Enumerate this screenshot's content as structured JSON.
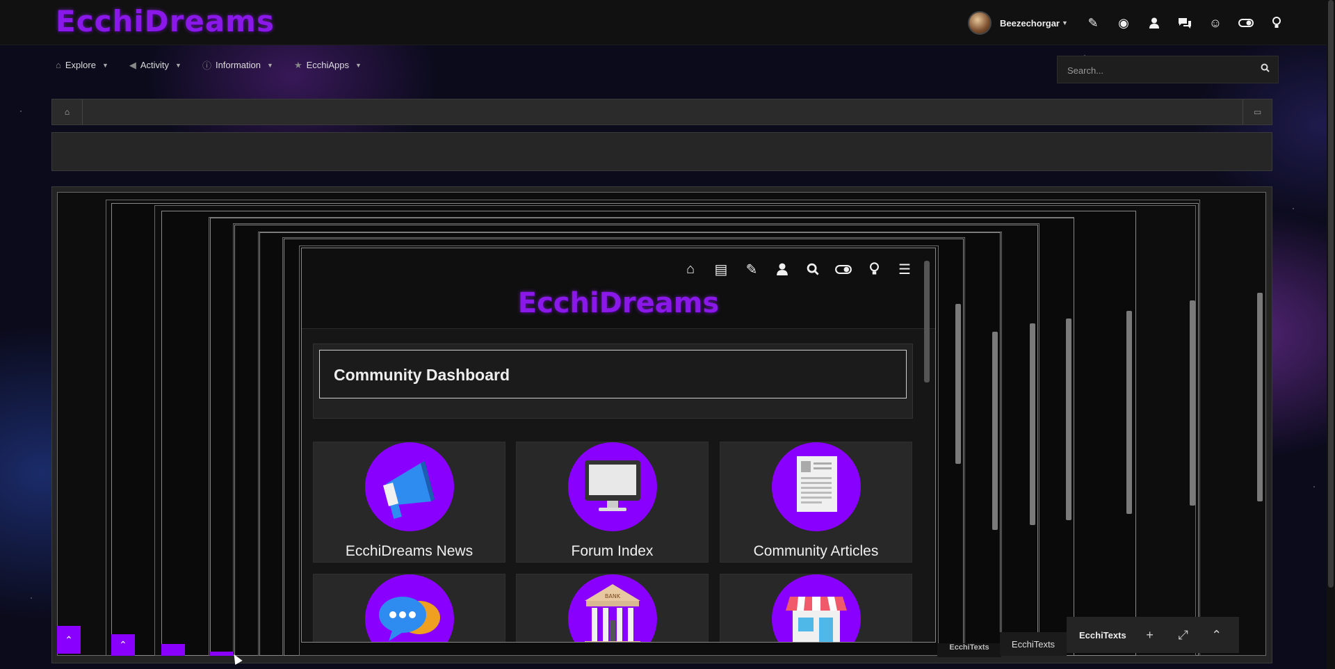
{
  "site": {
    "logo": "EcchiDreams"
  },
  "user": {
    "name": "Beezechorgar"
  },
  "topbar_icons": [
    "pencil-icon",
    "globe-icon",
    "user-icon",
    "comments-icon",
    "smile-icon",
    "toggle-icon",
    "lightbulb-icon"
  ],
  "nav": {
    "items": [
      {
        "label": "Explore",
        "icon": "home-icon"
      },
      {
        "label": "Activity",
        "icon": "bullhorn-icon"
      },
      {
        "label": "Information",
        "icon": "info-icon"
      },
      {
        "label": "EcchiApps",
        "icon": "star-icon"
      }
    ]
  },
  "search": {
    "placeholder": "Search..."
  },
  "inner_page": {
    "logo": "EcchiDreams",
    "dashboard_title": "Community Dashboard",
    "tiles": [
      {
        "label": "EcchiDreams News",
        "icon": "megaphone-icon"
      },
      {
        "label": "Forum Index",
        "icon": "monitor-icon"
      },
      {
        "label": "Community Articles",
        "icon": "document-icon"
      },
      {
        "label": "",
        "icon": "chat-bubbles-icon"
      },
      {
        "label": "",
        "icon": "bank-icon"
      },
      {
        "label": "",
        "icon": "shop-icon"
      }
    ],
    "bank_sign": "BANK"
  },
  "chat_dock": {
    "title": "EcchiTexts",
    "tab_label": "EcchiTexts",
    "tab_label_2": "EcchiTexts"
  },
  "colors": {
    "accent": "#8a00ff",
    "logo": "#8a18e8",
    "bar": "#111111"
  }
}
